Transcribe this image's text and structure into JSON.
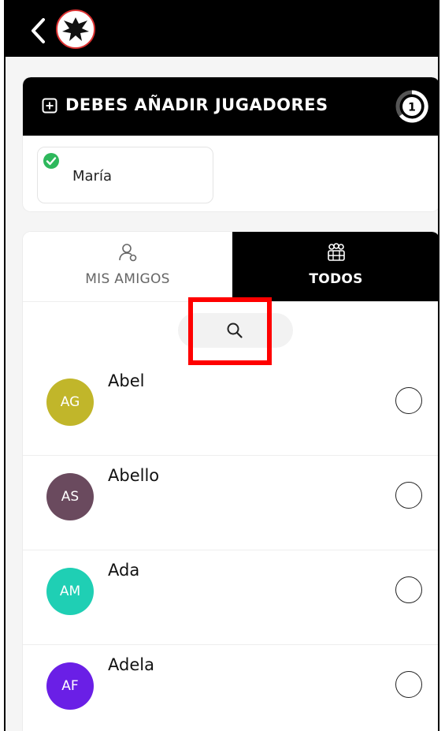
{
  "header": {
    "back_icon": "chevron-left-icon",
    "logo_icon": "eagle-crest-logo"
  },
  "requirement": {
    "title": "DEBES AÑADIR JUGADORES",
    "plus_icon": "square-plus-icon",
    "counter": "1",
    "selected_players": [
      {
        "name": "María",
        "status_icon": "check-circle-icon",
        "status_color": "#2eb85c"
      }
    ]
  },
  "tabs": [
    {
      "label": "MIS AMIGOS",
      "icon": "user-outline-icon",
      "active": false
    },
    {
      "label": "TODOS",
      "icon": "group-icon",
      "active": true
    }
  ],
  "search": {
    "icon": "search-icon"
  },
  "players": [
    {
      "initials": "AG",
      "name": "Abel",
      "color": "#c1b62a",
      "selected": false
    },
    {
      "initials": "AS",
      "name": "Abello",
      "color": "#6a4a5e",
      "selected": false
    },
    {
      "initials": "AM",
      "name": "Ada",
      "color": "#1fcfb4",
      "selected": false
    },
    {
      "initials": "AF",
      "name": "Adela",
      "color": "#6a1fe6",
      "selected": false
    }
  ],
  "colors": {
    "accent_black": "#000000",
    "highlight_red": "#ff0000"
  }
}
